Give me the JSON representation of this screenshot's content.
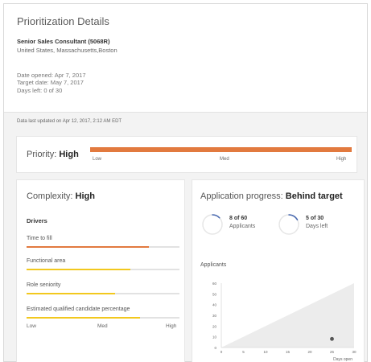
{
  "header": {
    "title": "Prioritization Details",
    "job_title": "Senior Sales Consultant (5068R)",
    "location": "United States, Massachusetts,Boston",
    "date_opened": "Date opened: Apr 7, 2017",
    "target_date": "Target date: May 7, 2017",
    "days_left": "Days left: 0 of 30"
  },
  "updated_text": "Data last updated on Apr 12, 2017, 2:12 AM EDT",
  "priority": {
    "label": "Priority:",
    "value": "High",
    "low": "Low",
    "med": "Med",
    "high": "High",
    "level_percent": 100,
    "bar_color": "#e27a3f"
  },
  "complexity": {
    "label": "Complexity:",
    "value": "High",
    "drivers_heading": "Drivers",
    "drivers": [
      {
        "label": "Time to fill",
        "level_percent": 80,
        "color": "#e27a3f"
      },
      {
        "label": "Functional area",
        "level_percent": 68,
        "color": "#f2c81e"
      },
      {
        "label": "Role seniority",
        "level_percent": 58,
        "color": "#f2c81e"
      },
      {
        "label": "Estimated qualified candidate percentage",
        "level_percent": 74,
        "color": "#f2c81e"
      }
    ],
    "low": "Low",
    "med": "Med",
    "high": "High"
  },
  "application_progress": {
    "label": "Application progress:",
    "value": "Behind target",
    "applicants_stat": {
      "value": "8 of 60",
      "label": "Applicants",
      "fraction": 0.13
    },
    "days_stat": {
      "value": "5 of 30",
      "label": "Days left",
      "fraction": 0.17
    },
    "ring_color": "#4a6ab0",
    "applicants_label": "Applicants"
  },
  "chart_data": {
    "type": "area",
    "xlabel": "Days open",
    "ylabel": "",
    "x_ticks": [
      "0",
      "5",
      "10",
      "15",
      "20",
      "25",
      "30"
    ],
    "y_ticks": [
      "0",
      "10",
      "20",
      "30",
      "40",
      "50",
      "60"
    ],
    "xlim": [
      0,
      30
    ],
    "ylim": [
      0,
      60
    ],
    "target_line": {
      "x": [
        0,
        30
      ],
      "y": [
        0,
        60
      ]
    },
    "points": [
      {
        "x": 25,
        "y": 8
      }
    ],
    "area_color": "#ececec",
    "point_color": "#555555"
  }
}
